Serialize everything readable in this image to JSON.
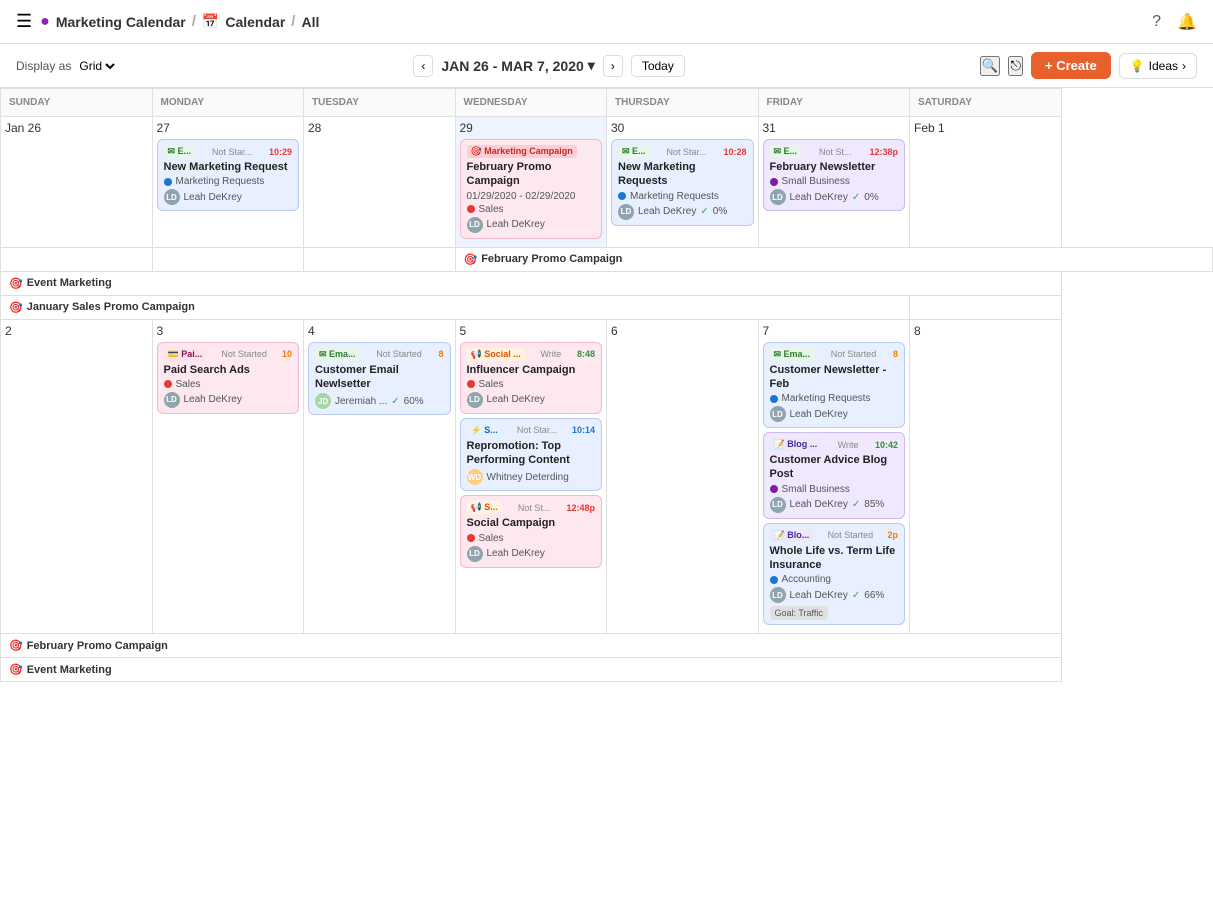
{
  "nav": {
    "hamburger": "☰",
    "app_icon": "●",
    "title": "Marketing Calendar",
    "sep1": "/",
    "calendar": "Calendar",
    "sep2": "/",
    "view": "All",
    "help_icon": "?",
    "notification_icon": "🔔"
  },
  "toolbar": {
    "display_as_label": "Display as",
    "grid_label": "Grid",
    "prev_icon": "‹",
    "next_icon": "›",
    "date_range": "JAN 26 - MAR 7, 2020",
    "chevron_down": "▾",
    "today_label": "Today",
    "search_icon": "🔍",
    "share_icon": "⎋",
    "create_label": "+ Create",
    "bulb_icon": "💡",
    "ideas_label": "Ideas",
    "ideas_arrow": "›"
  },
  "weekdays": [
    "SUNDAY",
    "MONDAY",
    "TUESDAY",
    "WEDNESDAY",
    "THURSDAY",
    "FRIDAY",
    "SATURDAY"
  ],
  "week1": {
    "days": [
      "Jan 26",
      "27",
      "28",
      "29",
      "30",
      "31",
      "Feb 1"
    ],
    "cards": {
      "mon": [
        {
          "tag": "E...",
          "tag_type": "email",
          "status": "Not Star...",
          "time": "10:29",
          "time_color": "red",
          "title": "New Marketing Request",
          "list": "Marketing Requests",
          "list_dot": "blue",
          "assignee": "Leah DeKrey",
          "avatar_type": "ld"
        }
      ],
      "wed": [
        {
          "tag": "Marketing Campaign",
          "tag_type": "marketing",
          "title": "February Promo Campaign",
          "subtitle": "01/29/2020 - 02/29/2020",
          "list": "Sales",
          "list_dot": "red",
          "assignee": "Leah DeKrey",
          "avatar_type": "ld"
        }
      ],
      "thu": [
        {
          "tag": "E...",
          "tag_type": "email",
          "status": "Not Star...",
          "time": "10:28",
          "time_color": "red",
          "title": "New Marketing Requests",
          "list": "Marketing Requests",
          "list_dot": "blue",
          "assignee": "Leah DeKrey",
          "avatar_type": "ld",
          "check_pct": "0%"
        }
      ],
      "fri": [
        {
          "tag": "E...",
          "tag_type": "email",
          "status": "Not St...",
          "time": "12:38p",
          "time_color": "red",
          "title": "February Newsletter",
          "list": "Small Business",
          "list_dot": "purple",
          "assignee": "Leah DeKrey",
          "avatar_type": "ld",
          "check_pct": "0%"
        }
      ]
    }
  },
  "banner1": {
    "label": "February Promo Campaign",
    "color": "pink"
  },
  "spanRow1": {
    "label_event": "Event Marketing",
    "label_promo": "January Sales Promo Campaign"
  },
  "week2": {
    "days": [
      "2",
      "3",
      "4",
      "5",
      "6",
      "7",
      "8"
    ],
    "cards": {
      "mon": [
        {
          "tag": "Pai...",
          "tag_type": "paid",
          "status": "Not Started",
          "time": "10",
          "time_color": "orange",
          "title": "Paid Search Ads",
          "list": "Sales",
          "list_dot": "red",
          "assignee": "Leah DeKrey",
          "avatar_type": "ld"
        }
      ],
      "tue": [
        {
          "tag": "Ema...",
          "tag_type": "email",
          "status": "Not Started",
          "time": "8",
          "time_color": "orange",
          "title": "Customer Email Newlsetter",
          "assignee": "Jeremiah ...",
          "avatar_type": "jd",
          "check_pct": "60%"
        }
      ],
      "wed": [
        {
          "tag": "Social ...",
          "tag_type": "social",
          "status": "Write",
          "time": "8:48",
          "time_color": "green",
          "title": "Influencer Campaign",
          "list": "Sales",
          "list_dot": "red",
          "assignee": "Leah DeKrey",
          "avatar_type": "ld"
        },
        {
          "tag": "S...",
          "tag_type": "task",
          "status": "Not Star...",
          "time": "10:14",
          "time_color": "blue_t",
          "title": "Repromotion: Top Performing Content",
          "assignee": "Whitney Deterding",
          "avatar_type": "wd"
        },
        {
          "tag": "S...",
          "tag_type": "social",
          "status": "Not St...",
          "time": "12:48p",
          "time_color": "red",
          "title": "Social Campaign",
          "list": "Sales",
          "list_dot": "red",
          "assignee": "Leah DeKrey",
          "avatar_type": "ld"
        }
      ],
      "fri": [
        {
          "tag": "Ema...",
          "tag_type": "email",
          "status": "Not Started",
          "time": "8",
          "time_color": "orange",
          "title": "Customer Newsletter - Feb",
          "list": "Marketing Requests",
          "list_dot": "blue",
          "assignee": "Leah DeKrey",
          "avatar_type": "ld"
        },
        {
          "tag": "Blog ...",
          "tag_type": "blog",
          "status": "Write",
          "time": "10:42",
          "time_color": "green",
          "title": "Customer Advice Blog Post",
          "list": "Small Business",
          "list_dot": "purple",
          "assignee": "Leah DeKrey",
          "avatar_type": "ld",
          "check_pct": "85%"
        },
        {
          "tag": "Blo...",
          "tag_type": "blog",
          "status": "Not Started",
          "time": "2p",
          "time_color": "orange",
          "title": "Whole Life vs. Term Life Insurance",
          "list": "Accounting",
          "list_dot": "blue",
          "assignee": "Leah DeKrey",
          "avatar_type": "ld",
          "check_pct": "66%",
          "goal": "Goal: Traffic"
        }
      ]
    }
  },
  "banner2": {
    "label": "February Promo Campaign",
    "color": "pink"
  },
  "banner3": {
    "label": "Event Marketing",
    "color": "blue"
  }
}
